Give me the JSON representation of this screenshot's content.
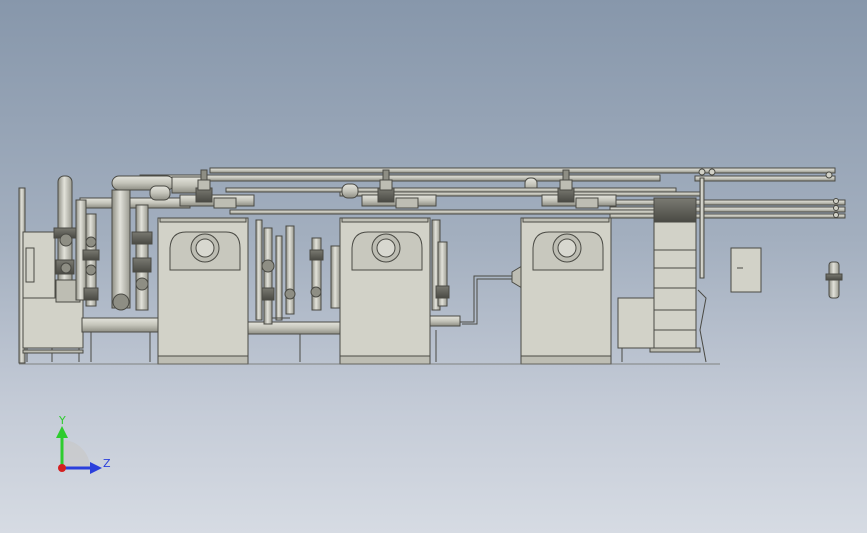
{
  "viewport": {
    "background_top": "#8797ab",
    "background_bottom": "#d6dbe3"
  },
  "model": {
    "line_color": "#4a4a44",
    "body_color": "#d2d2c8",
    "pipe_color": "#c4c4ba",
    "pipe_shade": "#9e9e94",
    "dark_color": "#5a5a54",
    "boiler_count": 3
  },
  "triad": {
    "y_label": "Y",
    "z_label": "Z",
    "y_color": "#2ecc2e",
    "z_color": "#2a3fdc",
    "origin_color": "#d42020"
  }
}
